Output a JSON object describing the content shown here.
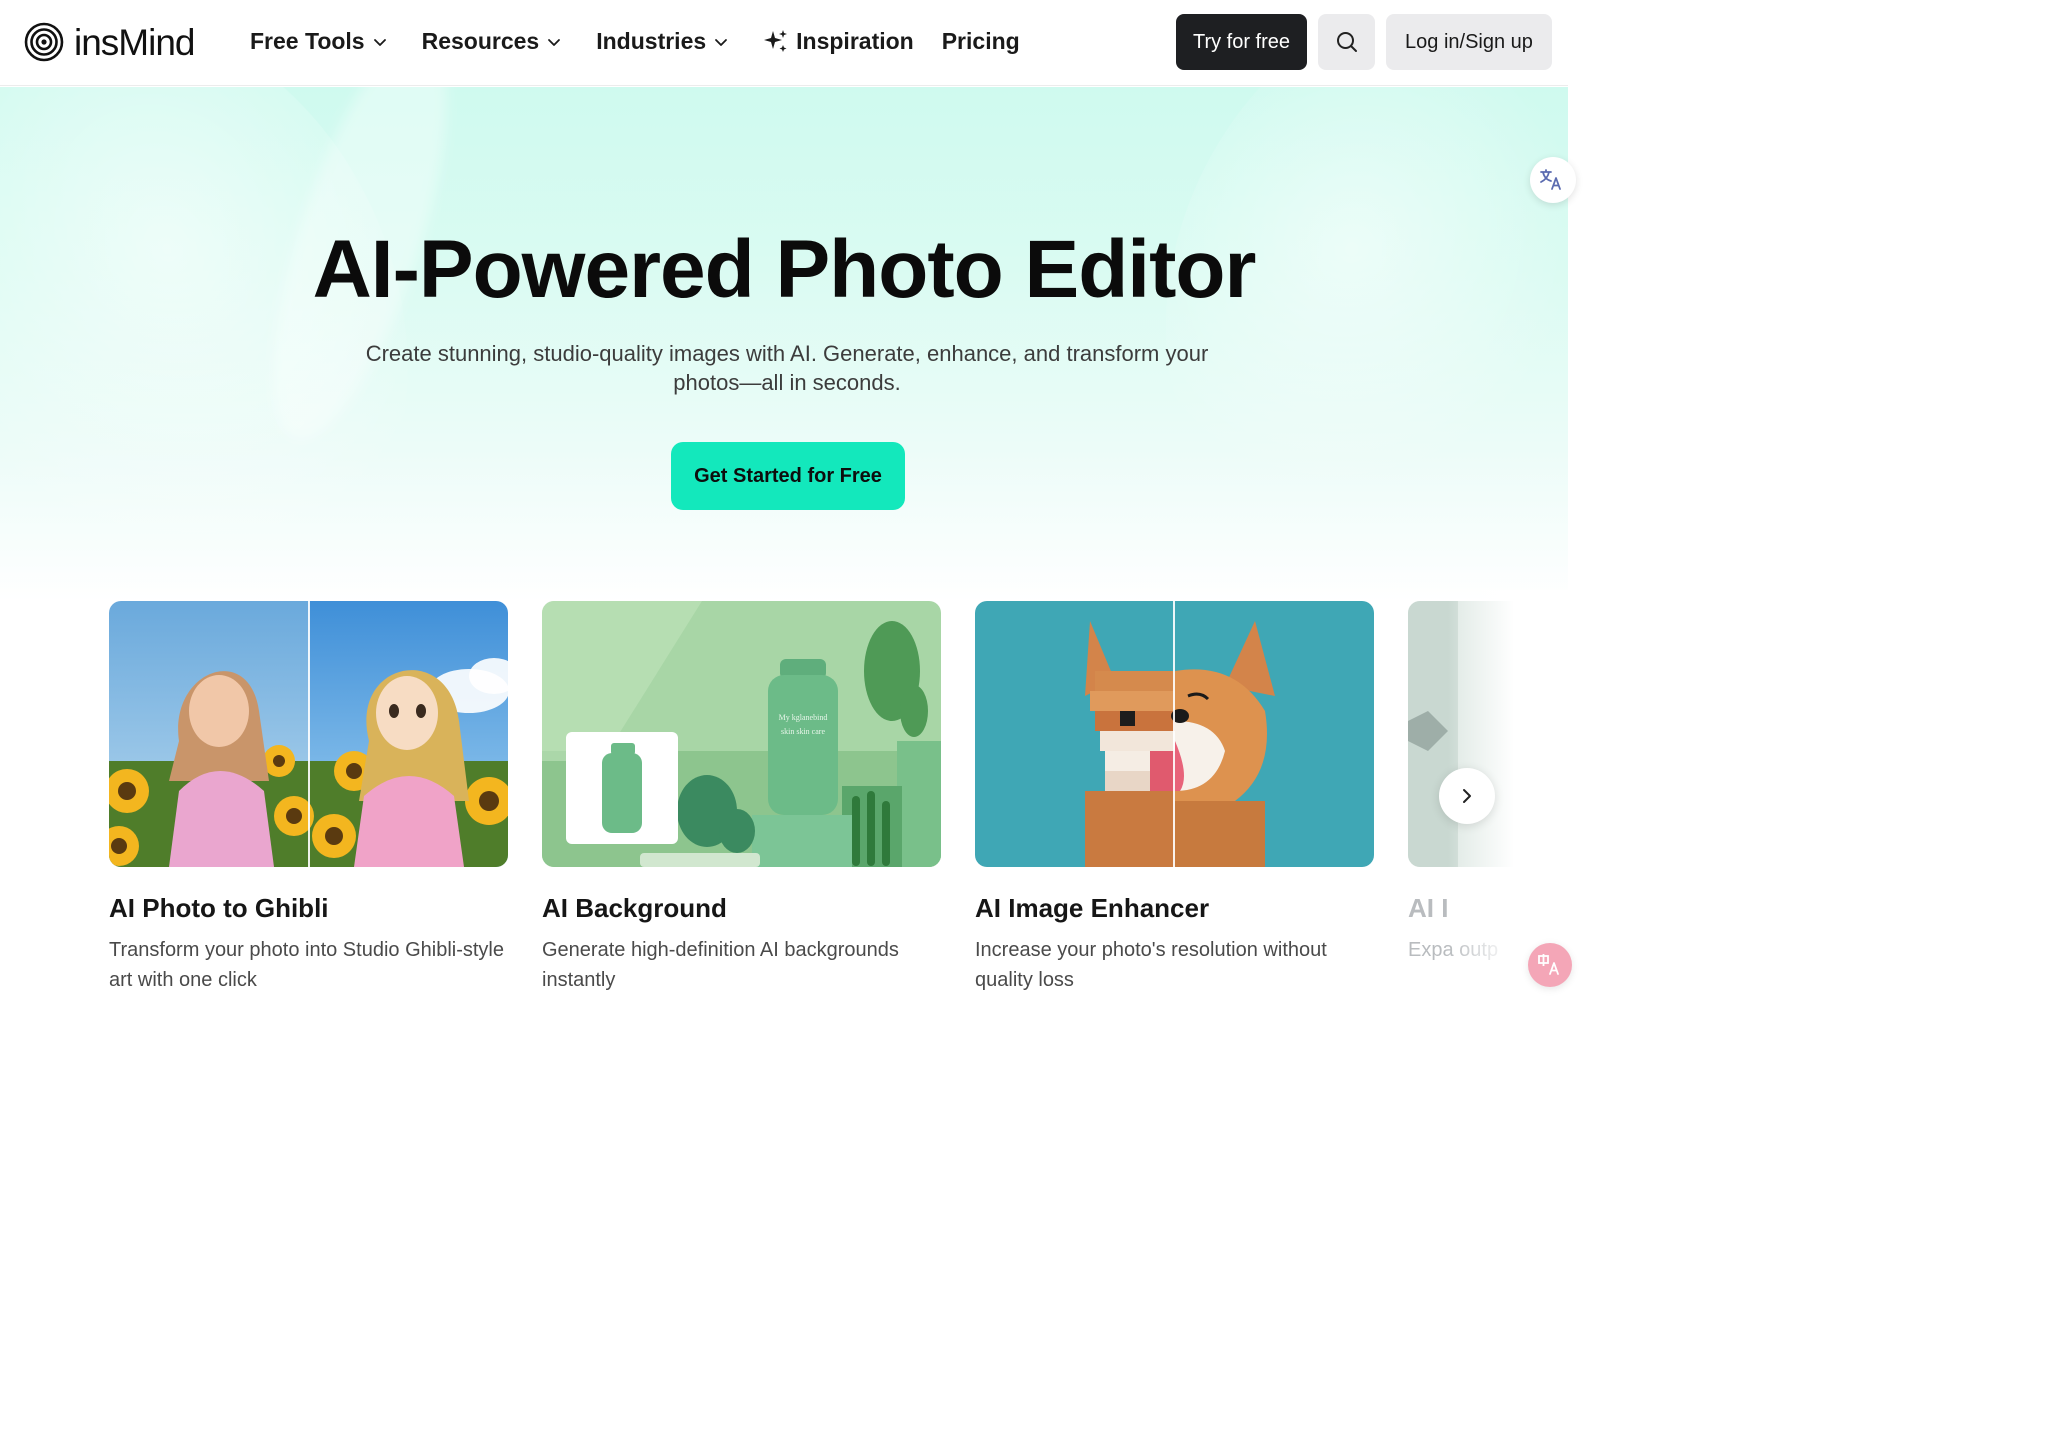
{
  "brand": {
    "name": "insMind"
  },
  "nav": {
    "items": [
      {
        "label": "Free Tools",
        "has_dropdown": true
      },
      {
        "label": "Resources",
        "has_dropdown": true
      },
      {
        "label": "Industries",
        "has_dropdown": true
      },
      {
        "label": "Inspiration",
        "icon": "sparkle-icon"
      },
      {
        "label": "Pricing"
      }
    ],
    "try_label": "Try for free",
    "search_icon": "search-icon",
    "login_label": "Log in/Sign up"
  },
  "hero": {
    "title": "AI-Powered Photo Editor",
    "subtitle": "Create stunning, studio-quality images with AI. Generate, enhance, and transform your photos—all in seconds.",
    "cta_label": "Get Started for Free"
  },
  "cards": [
    {
      "title": "AI Photo to Ghibli",
      "description": "Transform your photo into Studio Ghibli-style art with one click",
      "image": "girl-in-sunflowers-before-after"
    },
    {
      "title": "AI Background",
      "description": "Generate high-definition AI backgrounds instantly",
      "image": "green-skincare-bottle-with-cactus",
      "bottle_text": [
        "My kglanebind",
        "skin skin care"
      ]
    },
    {
      "title": "AI Image Enhancer",
      "description": "Increase your photo's resolution without quality loss",
      "image": "corgi-pixelated-vs-sharp"
    },
    {
      "title": "AI I",
      "description": "Expa outp",
      "image": "partially-visible-card"
    }
  ],
  "carousel": {
    "next_icon": "chevron-right-icon"
  },
  "widgets": {
    "translate_icon": "translate-icon",
    "translate_zh_icon": "translate-zh-icon"
  },
  "colors": {
    "accent": "#13e8bc",
    "hero_bg": "#d6fbf1",
    "dark_button": "#1e1f22",
    "light_button": "#ebebed"
  }
}
